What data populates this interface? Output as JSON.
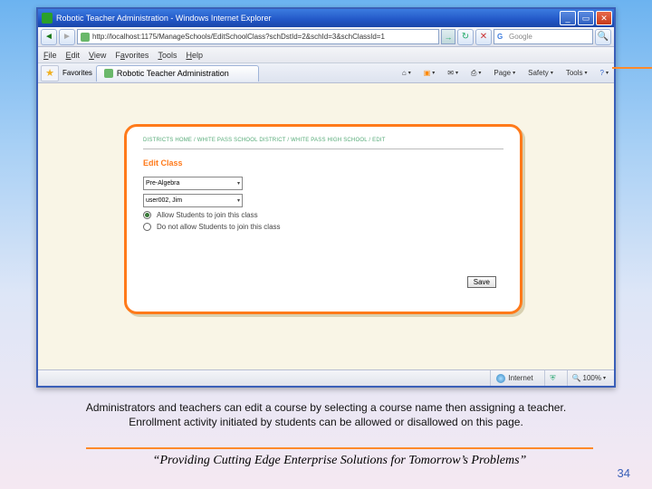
{
  "window": {
    "title": "Robotic Teacher Administration - Windows Internet Explorer"
  },
  "nav": {
    "url": "http://localhost:1175/ManageSchools/EditSchoolClass?schDstId=2&schId=3&schClassId=1",
    "search_placeholder": "Google"
  },
  "menu": {
    "file": "File",
    "edit": "Edit",
    "view": "View",
    "favorites": "Favorites",
    "tools": "Tools",
    "help": "Help"
  },
  "tabbar": {
    "fav_label": "Favorites",
    "tab_title": "Robotic Teacher Administration"
  },
  "toolbar": {
    "home": "",
    "page": "Page",
    "safety": "Safety",
    "tools": "Tools"
  },
  "panel": {
    "breadcrumb": "DISTRICTS HOME / WHITE PASS SCHOOL DISTRICT / WHITE PASS HIGH SCHOOL / EDIT",
    "title": "Edit Class",
    "course_select": "Pre-Algebra",
    "teacher_select": "user002, Jim",
    "radio_allow": "Allow Students to join this class",
    "radio_disallow": "Do not allow Students to join this class",
    "save": "Save"
  },
  "status": {
    "zone": "Internet",
    "zoom": "100%"
  },
  "caption": {
    "line1": "Administrators and teachers can edit a course by selecting a course name then assigning a teacher.",
    "line2": "Enrollment activity initiated by students can be allowed or disallowed on this page."
  },
  "tagline": "“Providing Cutting Edge Enterprise Solutions for Tomorrow’s Problems”",
  "page_number": "34"
}
